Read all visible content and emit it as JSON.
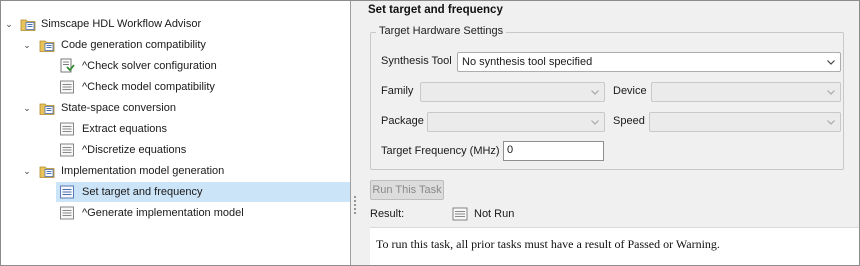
{
  "tree": {
    "root": {
      "label": "Simscape HDL Workflow Advisor",
      "icon": "folder-advisor-icon"
    },
    "groups": [
      {
        "label": "Code generation compatibility",
        "icon": "folder-advisor-icon",
        "items": [
          {
            "label": "^Check solver configuration",
            "icon": "task-run-icon"
          },
          {
            "label": "^Check model compatibility",
            "icon": "task-page-icon"
          }
        ]
      },
      {
        "label": "State-space conversion",
        "icon": "folder-advisor-icon",
        "items": [
          {
            "label": "Extract equations",
            "icon": "task-page-icon"
          },
          {
            "label": "^Discretize equations",
            "icon": "task-page-icon"
          }
        ]
      },
      {
        "label": "Implementation model generation",
        "icon": "folder-advisor-icon",
        "items": [
          {
            "label": "Set target and frequency",
            "icon": "task-page-icon",
            "selected": true
          },
          {
            "label": "^Generate implementation model",
            "icon": "task-page-icon"
          }
        ]
      }
    ]
  },
  "task": {
    "title": "Set target and frequency",
    "group_title": "Target Hardware Settings",
    "synthesis_tool": {
      "label": "Synthesis Tool",
      "value": "No synthesis tool specified"
    },
    "family": {
      "label": "Family",
      "value": ""
    },
    "device": {
      "label": "Device",
      "value": ""
    },
    "package": {
      "label": "Package",
      "value": ""
    },
    "speed": {
      "label": "Speed",
      "value": ""
    },
    "target_frequency": {
      "label": "Target Frequency (MHz)",
      "value": "0"
    },
    "run_button": "Run This Task",
    "result_label": "Result:",
    "result_value": "Not Run",
    "message": "To run this task, all prior tasks must have a result of Passed or Warning."
  },
  "colors": {
    "selection": "#cce4f7",
    "panel_bg": "#f0f0f0",
    "folder_yellow": "#e8c25a",
    "icon_blue": "#4a6fb5"
  }
}
